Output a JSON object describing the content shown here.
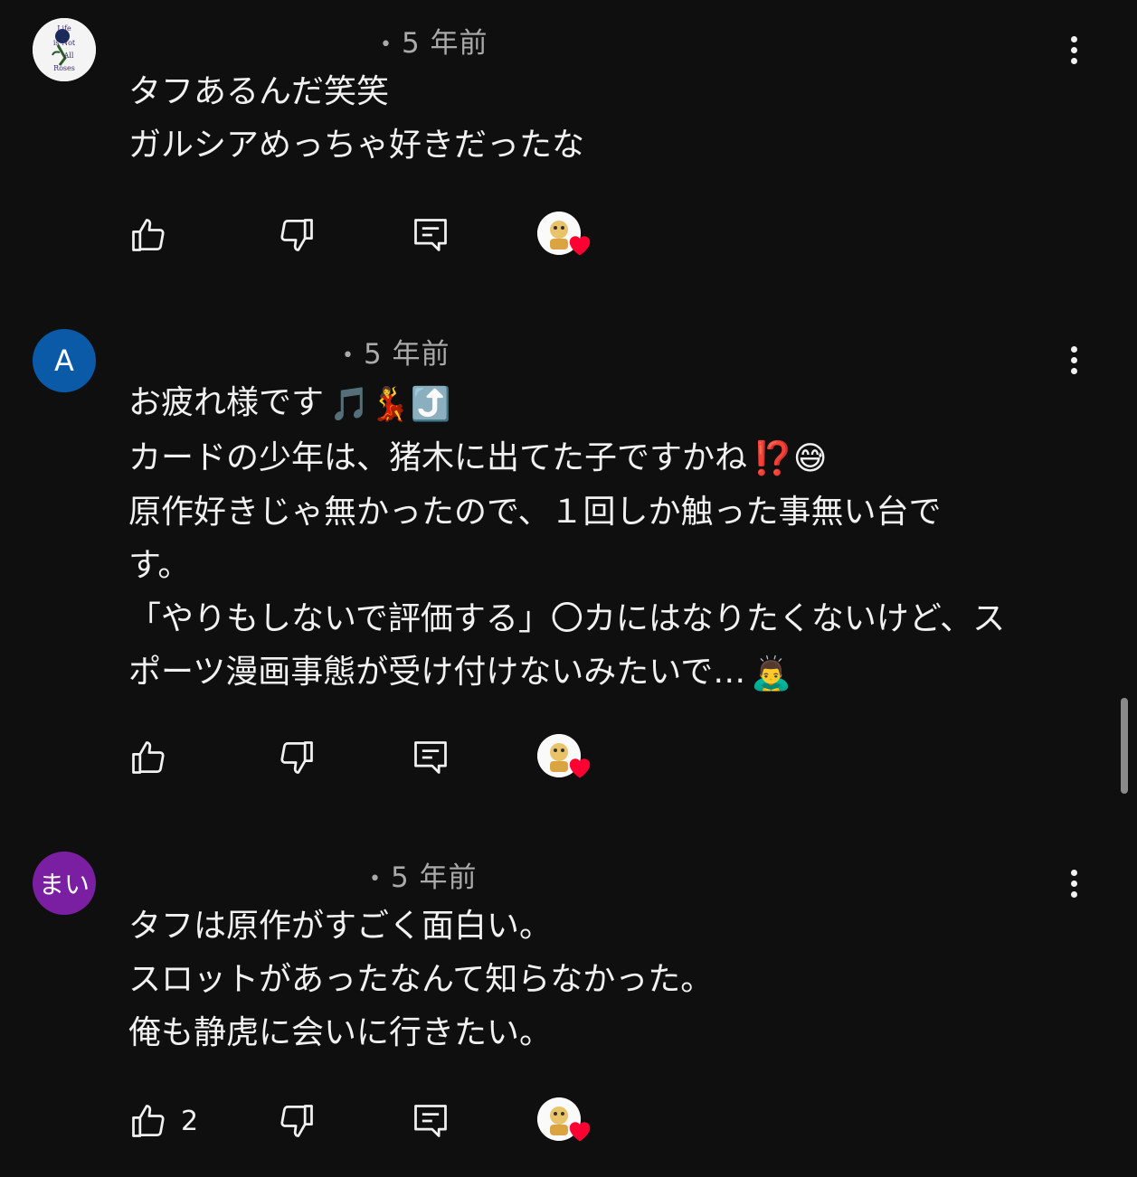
{
  "comments": [
    {
      "avatar": {
        "type": "image",
        "text": "Life is Not All Roses",
        "bg": "#f4f4f4"
      },
      "time": "5 年前",
      "lines": [
        "タフあるんだ笑笑",
        "ガルシアめっちゃ好きだったな"
      ],
      "like_count": ""
    },
    {
      "avatar": {
        "type": "letter",
        "text": "A",
        "bg": "#0a5aa8"
      },
      "time": "5 年前",
      "lines": [
        "お疲れ様です",
        "カードの少年は、猪木に出てた子ですかね",
        "原作好きじゃ無かったので、１回しか触った事無い台で",
        "す。",
        "「やりもしないで評価する」〇カにはなりたくないけど、ス",
        "ポーツ漫画事態が受け付けないみたいで…"
      ],
      "emojis": {
        "line0": "🎵💃⤴️",
        "line1": "⁉️😅",
        "line5": "🙇‍♂️"
      },
      "like_count": ""
    },
    {
      "avatar": {
        "type": "letter",
        "text": "まい",
        "bg": "#7b1fa2"
      },
      "time": "5 年前",
      "lines": [
        "タフは原作がすごく面白い。",
        "スロットがあったなんて知らなかった。",
        "俺も静虎に会いに行きたい。"
      ],
      "like_count": "2"
    }
  ],
  "icons": {
    "like": "thumbs-up-icon",
    "dislike": "thumbs-down-icon",
    "reply": "reply-icon",
    "more": "more-vert-icon",
    "creator_heart": "creator-heart-icon"
  },
  "colors": {
    "background": "#0f0f0f",
    "text": "#f1f1f1",
    "meta": "#aaaaaa",
    "heart": "#ff0033"
  }
}
